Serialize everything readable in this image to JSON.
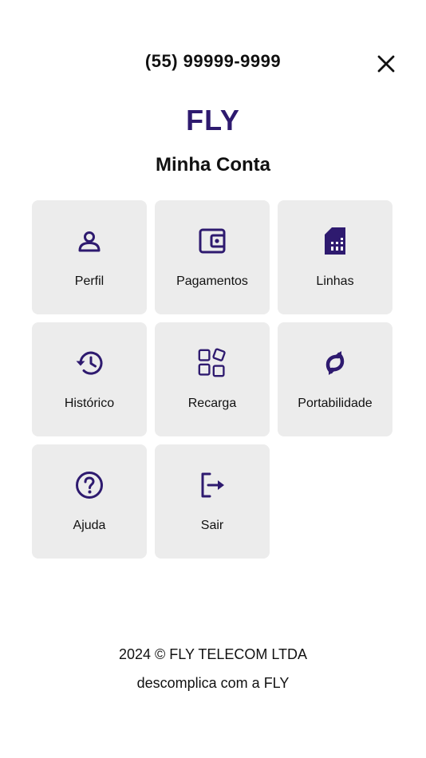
{
  "header": {
    "phone": "(55) 99999-9999"
  },
  "brand": {
    "logo_text": "FLY",
    "color": "#2e1a6f"
  },
  "page": {
    "title": "Minha Conta"
  },
  "menu": {
    "items": [
      {
        "label": "Perfil",
        "icon": "user-icon"
      },
      {
        "label": "Pagamentos",
        "icon": "wallet-icon"
      },
      {
        "label": "Linhas",
        "icon": "sim-card-icon"
      },
      {
        "label": "Histórico",
        "icon": "history-icon"
      },
      {
        "label": "Recarga",
        "icon": "apps-grid-icon"
      },
      {
        "label": "Portabilidade",
        "icon": "sync-icon"
      },
      {
        "label": "Ajuda",
        "icon": "help-circle-icon"
      },
      {
        "label": "Sair",
        "icon": "logout-icon"
      }
    ]
  },
  "footer": {
    "copyright": "2024 ©  FLY TELECOM LTDA",
    "tagline": "descomplica com a  FLY"
  },
  "colors": {
    "tile_background": "#ececec",
    "icon": "#2e1a6f",
    "text": "#111111"
  }
}
